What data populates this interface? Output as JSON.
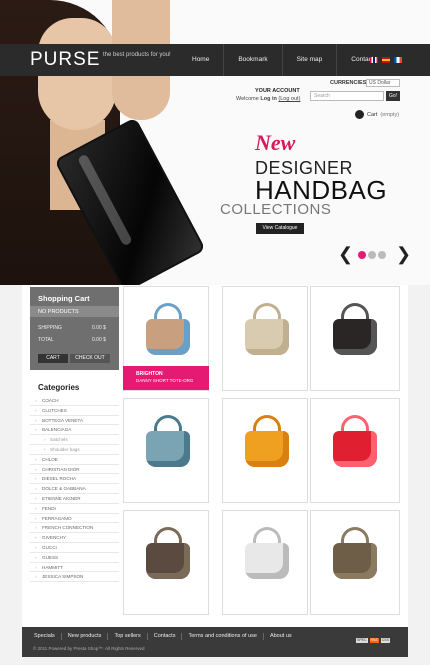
{
  "header": {
    "logo": "PURSE",
    "tagline": "the best products for you!",
    "nav": [
      "Home",
      "Bookmark",
      "Site map",
      "Contacts"
    ],
    "flags": [
      {
        "name": "english-flag-icon",
        "colors": [
          "#c8102e",
          "#fff"
        ]
      },
      {
        "name": "spanish-flag-icon",
        "colors": [
          "#c60b1e",
          "#ffc400"
        ]
      },
      {
        "name": "french-flag-icon",
        "colors": [
          "#0055a4",
          "#ef4135"
        ]
      }
    ],
    "currency_label": "CURRENCIES",
    "currency_value": "US Dollar",
    "account_label": "YOUR ACCOUNT",
    "welcome_prefix": "Welcome",
    "welcome_link": "Log in",
    "welcome_suffix": "(Log out)",
    "search_placeholder": "Search",
    "search_button": "Go!",
    "cart_mini_count": "Cart",
    "cart_mini_state": "(empty)"
  },
  "promo": {
    "new": "New",
    "line1": "DESIGNER",
    "line2": "HANDBAG",
    "line3": "COLLECTIONS",
    "button": "View Catalogue",
    "accent": "#e51a72",
    "dots": [
      "active",
      "inactive",
      "inactive"
    ]
  },
  "cart": {
    "title": "Shopping Cart",
    "subtitle": "NO PRODUCTS",
    "rows": [
      {
        "label": "SHIPPING",
        "value": "0.00 $"
      },
      {
        "label": "TOTAL",
        "value": "0.00 $"
      }
    ],
    "cart_button": "CART",
    "checkout_button": "CHECK OUT"
  },
  "categories": {
    "title": "Categories",
    "items": [
      {
        "label": "COACH",
        "sub": false
      },
      {
        "label": "CLUTCHES",
        "sub": false
      },
      {
        "label": "BOTTEGA VENETA",
        "sub": false
      },
      {
        "label": "BALENCIAGA",
        "sub": false
      },
      {
        "label": "Satchels",
        "sub": true
      },
      {
        "label": "Shoulder bags",
        "sub": true
      },
      {
        "label": "CHLOE",
        "sub": false
      },
      {
        "label": "CHRISTIAN DIOR",
        "sub": false
      },
      {
        "label": "DIESEL ROCHA",
        "sub": false
      },
      {
        "label": "DOLCE & GABBANA",
        "sub": false
      },
      {
        "label": "ETIENNE AIGNER",
        "sub": false
      },
      {
        "label": "FENDI",
        "sub": false
      },
      {
        "label": "FERRAGAMO",
        "sub": false
      },
      {
        "label": "FRENCH CONNECTION",
        "sub": false
      },
      {
        "label": "GIVENCHY",
        "sub": false
      },
      {
        "label": "GUCCI",
        "sub": false
      },
      {
        "label": "GUESS",
        "sub": false
      },
      {
        "label": "HAMMITT",
        "sub": false
      },
      {
        "label": "JESSICA SIMPSON",
        "sub": false
      }
    ]
  },
  "products": [
    {
      "name": "plaid-tote-bag",
      "color": "#c8a080",
      "accent": "#6aa0c8",
      "label1": "BRIGHTON",
      "label2": "DANNY SHORT TOTE-ORG"
    },
    {
      "name": "beige-leather-bag",
      "color": "#d8cbb0",
      "accent": "#c0b090"
    },
    {
      "name": "black-quilted-bag",
      "color": "#2a2625",
      "accent": "#555"
    },
    {
      "name": "teal-quilted-bag",
      "color": "#7aa4b4",
      "accent": "#4a7a8c"
    },
    {
      "name": "orange-tote-bag",
      "color": "#f0a020",
      "accent": "#d88010"
    },
    {
      "name": "red-patent-bag",
      "color": "#e02030",
      "accent": "#ff6070"
    },
    {
      "name": "brown-crossbody-bag",
      "color": "#5a4a40",
      "accent": "#7a6a58"
    },
    {
      "name": "white-satchel-bag",
      "color": "#e8e8e8",
      "accent": "#bbb"
    },
    {
      "name": "taupe-shoulder-bag",
      "color": "#6e5e48",
      "accent": "#8a7a60"
    }
  ],
  "footer": {
    "links": [
      "Specials",
      "New products",
      "Top sellers",
      "Contacts",
      "Terms and conditions of use",
      "About us"
    ],
    "copyright": "© 2011 Powered by Presta Shop™. All Rights Reserved",
    "badges": [
      "SPEC",
      "RSS",
      "CSS"
    ]
  }
}
